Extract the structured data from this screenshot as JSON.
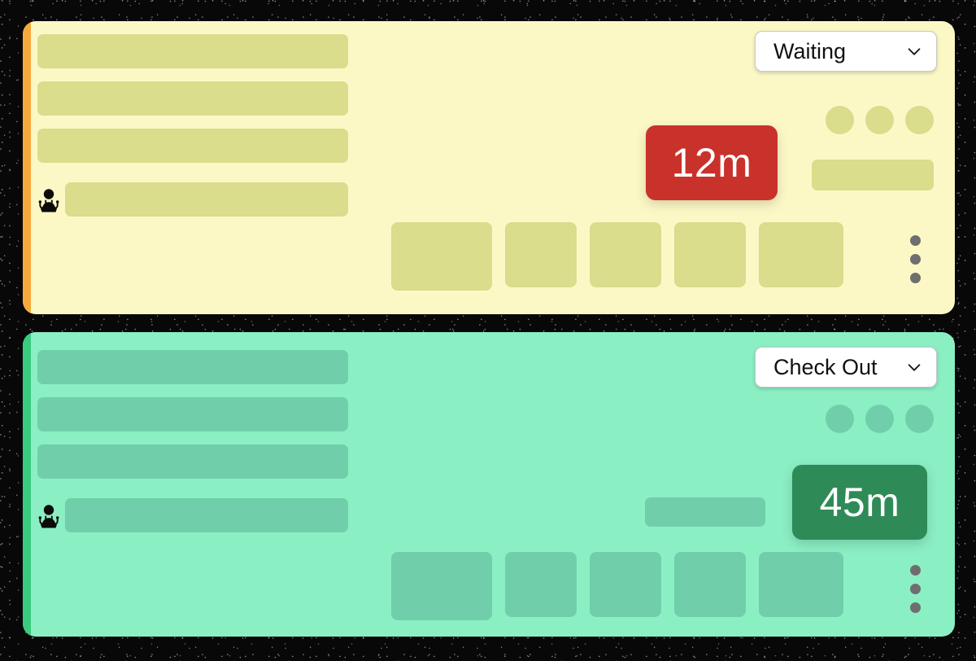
{
  "page": {
    "background_color": "#080808"
  },
  "cards": [
    {
      "id": "waiting-card",
      "accent_color": "#F6A93B",
      "background_color": "#FCF8C6",
      "placeholder_color": "#D9DD8C",
      "status": {
        "label": "Waiting",
        "chevron": "chevron-down-icon"
      },
      "provider_icon": "doctor-icon",
      "time_badge": {
        "value": "12m",
        "color": "#C9322B"
      },
      "avatar_dots": 3,
      "tiles": 5,
      "kebab_dots": 3
    },
    {
      "id": "check-out-card",
      "accent_color": "#3ACB7F",
      "background_color": "#8BEFC4",
      "placeholder_color": "#70CFAA",
      "status": {
        "label": "Check Out",
        "chevron": "chevron-down-icon"
      },
      "provider_icon": "doctor-icon",
      "time_badge": {
        "value": "45m",
        "color": "#2E8B57"
      },
      "avatar_dots": 3,
      "tiles": 5,
      "kebab_dots": 3
    }
  ]
}
